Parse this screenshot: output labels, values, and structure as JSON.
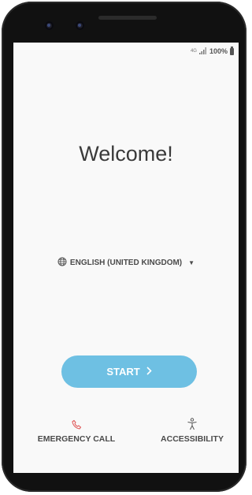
{
  "status_bar": {
    "network": "4G",
    "battery": "100%"
  },
  "welcome": {
    "title": "Welcome!"
  },
  "language": {
    "label": "ENGLISH (UNITED KINGDOM)"
  },
  "start": {
    "label": "START"
  },
  "bottom": {
    "emergency_label": "EMERGENCY CALL",
    "accessibility_label": "ACCESSIBILITY"
  },
  "colors": {
    "start_button": "#6ec0e3",
    "emergency_icon": "#e05a5a",
    "screen_bg": "#f9f9f9"
  },
  "icons": {
    "language": "globe-icon",
    "dropdown": "caret-down-icon",
    "start": "chevron-right-icon",
    "emergency": "phone-icon",
    "accessibility": "accessibility-person-icon"
  }
}
